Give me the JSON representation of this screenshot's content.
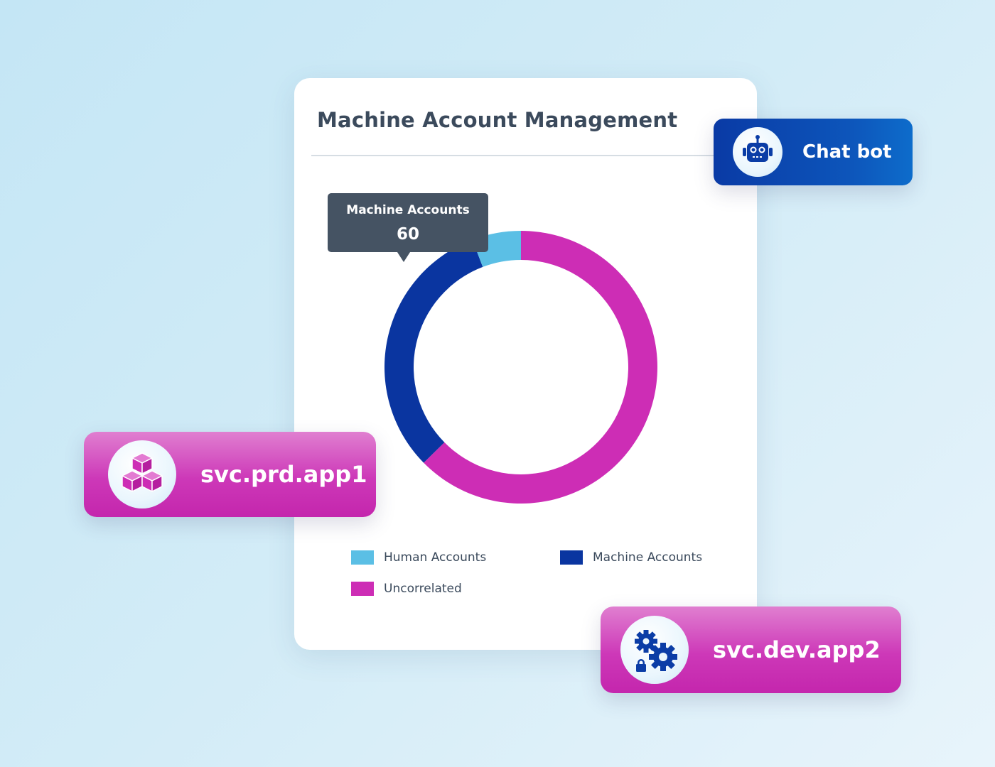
{
  "card": {
    "title": "Machine Account Management"
  },
  "chart_data": {
    "type": "pie",
    "variant": "donut",
    "categories": [
      "Human Accounts",
      "Machine Accounts",
      "Uncorrelated"
    ],
    "values": [
      11,
      60,
      119
    ],
    "colors": [
      "#5bbfe5",
      "#0a35a0",
      "#cd2db5"
    ],
    "legend_position": "bottom",
    "tooltip": {
      "label": "Machine Accounts",
      "value": "60"
    }
  },
  "chips": {
    "chatbot": {
      "label": "Chat bot",
      "icon": "robot-icon"
    },
    "prd": {
      "label": "svc.prd.app1",
      "icon": "cubes-icon"
    },
    "dev": {
      "label": "svc.dev.app2",
      "icon": "gears-lock-icon"
    }
  }
}
